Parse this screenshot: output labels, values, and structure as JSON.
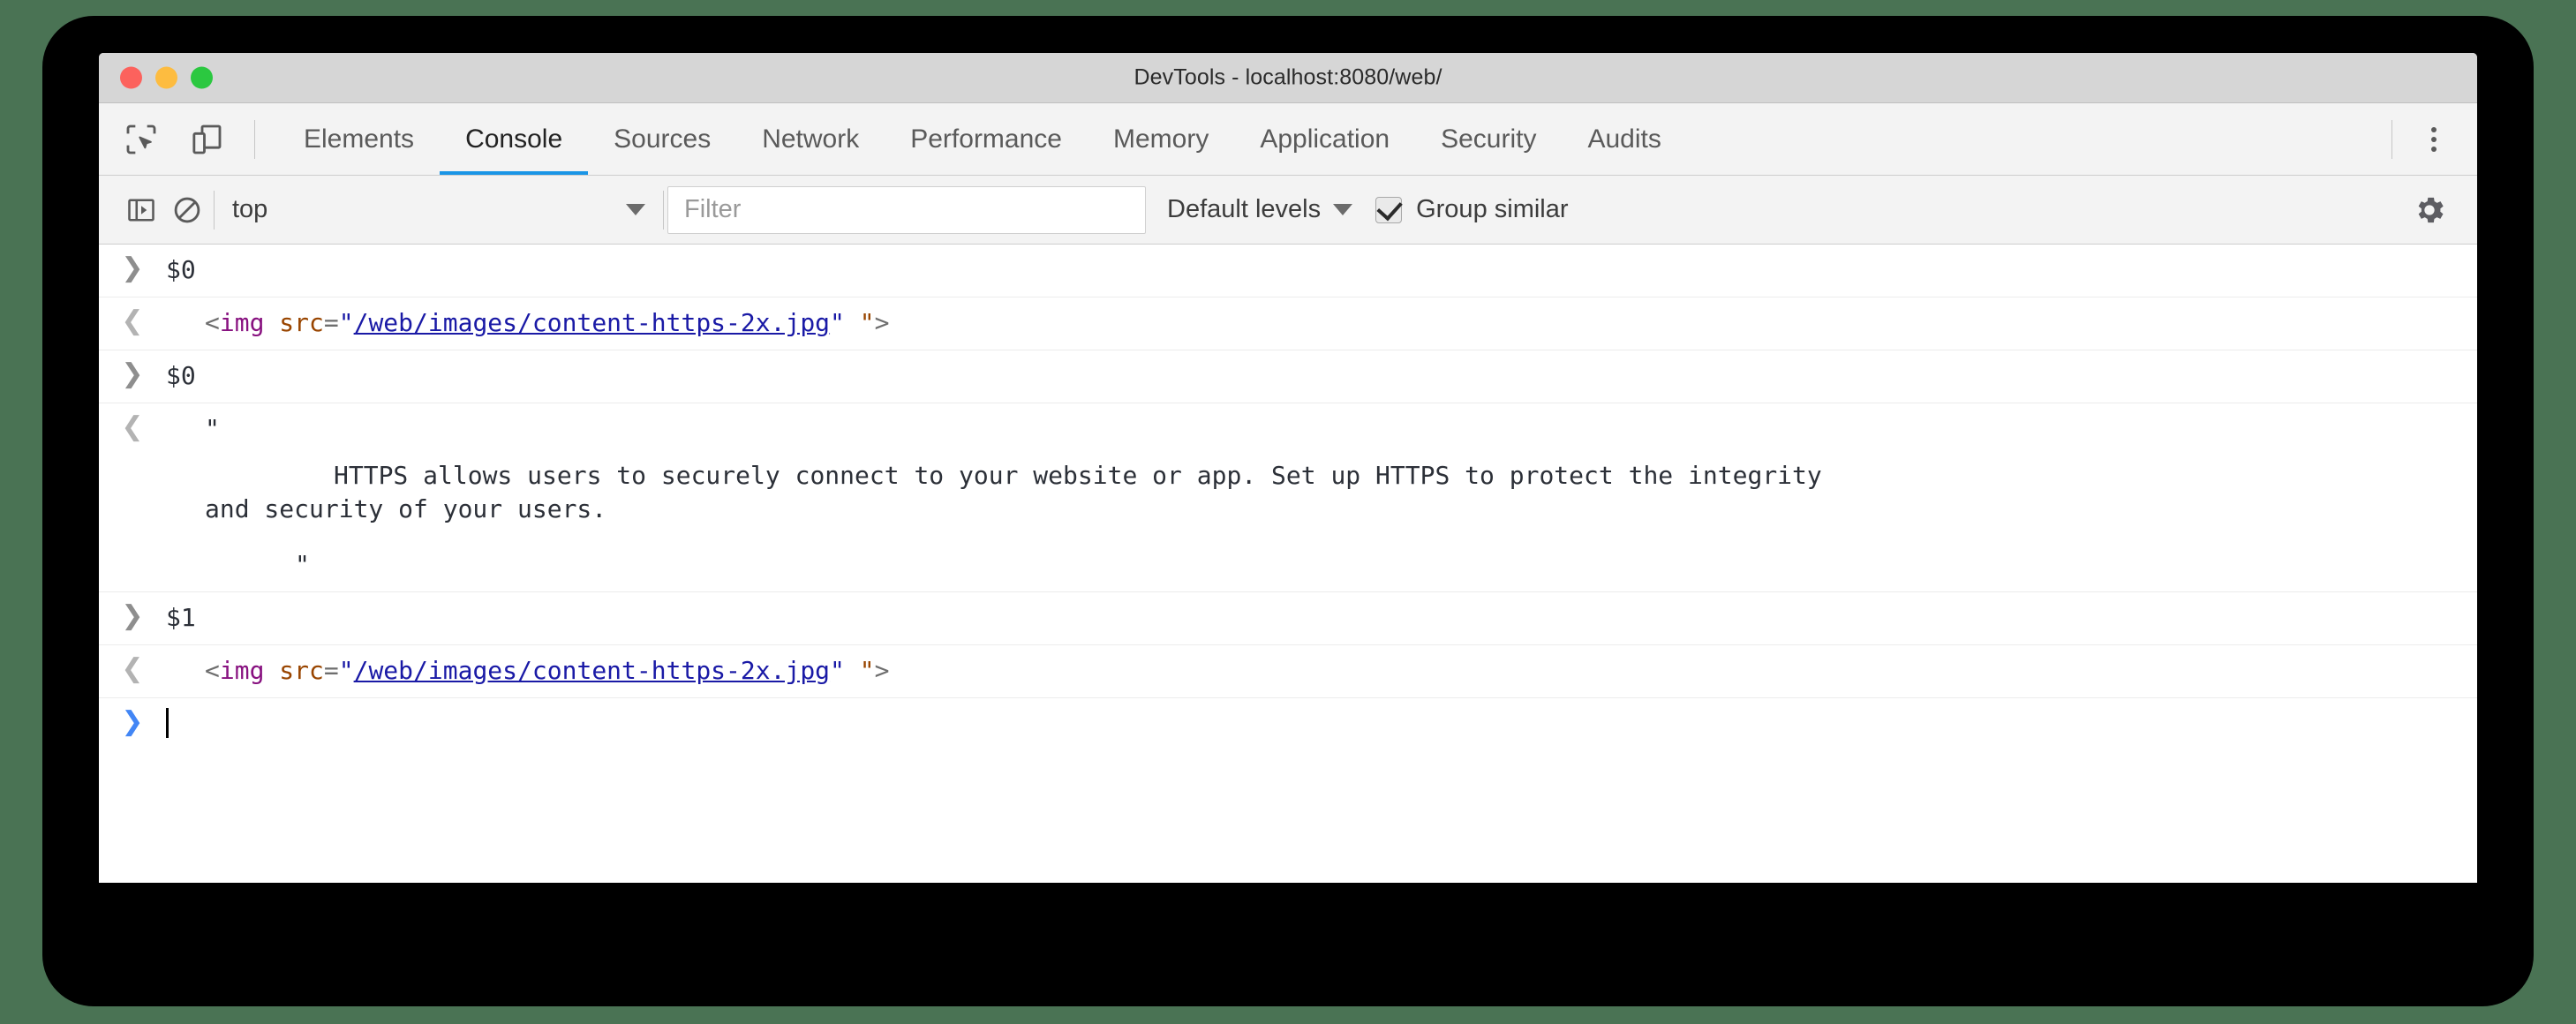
{
  "window": {
    "title": "DevTools - localhost:8080/web/",
    "traffic_lights": [
      "close",
      "minimize",
      "zoom"
    ]
  },
  "tabbar": {
    "inspect_icon": "inspect-element-icon",
    "device_icon": "device-toolbar-icon",
    "tabs": [
      {
        "label": "Elements",
        "active": false
      },
      {
        "label": "Console",
        "active": true
      },
      {
        "label": "Sources",
        "active": false
      },
      {
        "label": "Network",
        "active": false
      },
      {
        "label": "Performance",
        "active": false
      },
      {
        "label": "Memory",
        "active": false
      },
      {
        "label": "Application",
        "active": false
      },
      {
        "label": "Security",
        "active": false
      },
      {
        "label": "Audits",
        "active": false
      }
    ],
    "more_label": "more-options"
  },
  "console_toolbar": {
    "sidebar_toggle": "console-sidebar-toggle-icon",
    "clear_console": "clear-console-icon",
    "context": "top",
    "filter_placeholder": "Filter",
    "levels_label": "Default levels",
    "group_similar_label": "Group similar",
    "group_similar_checked": true,
    "settings_icon": "settings-gear-icon"
  },
  "console_rows": [
    {
      "type": "input",
      "text": "$0"
    },
    {
      "type": "output-html",
      "tokens": {
        "open": "<",
        "tag": "img",
        "space": " ",
        "attr": "src",
        "eq": "=",
        "quote_open": "\"",
        "url": "/web/images/content-https-2x.jpg",
        "quote_close": "\"",
        "gap": " ",
        "quote_extra": "\"",
        "close": ">"
      }
    },
    {
      "type": "input",
      "text": "$0"
    },
    {
      "type": "output-string",
      "quote_open": "\"",
      "body_line_1": "HTTPS allows users to securely connect to your website or app. Set up HTTPS to protect the integrity",
      "body_line_2": "and security of your users.",
      "quote_close": "\""
    },
    {
      "type": "input",
      "text": "$1"
    },
    {
      "type": "output-html",
      "tokens": {
        "open": "<",
        "tag": "img",
        "space": " ",
        "attr": "src",
        "eq": "=",
        "quote_open": "\"",
        "url": "/web/images/content-https-2x.jpg",
        "quote_close": "\"",
        "gap": " ",
        "quote_extra": "\"",
        "close": ">"
      }
    },
    {
      "type": "prompt",
      "text": ""
    }
  ],
  "colors": {
    "accent_blue": "#1a95e6",
    "prompt_blue": "#4286f5",
    "tag_purple": "#881280",
    "attr_orange": "#994500",
    "value_blue": "#1a1aa6",
    "backdrop_green": "#4a7354"
  }
}
